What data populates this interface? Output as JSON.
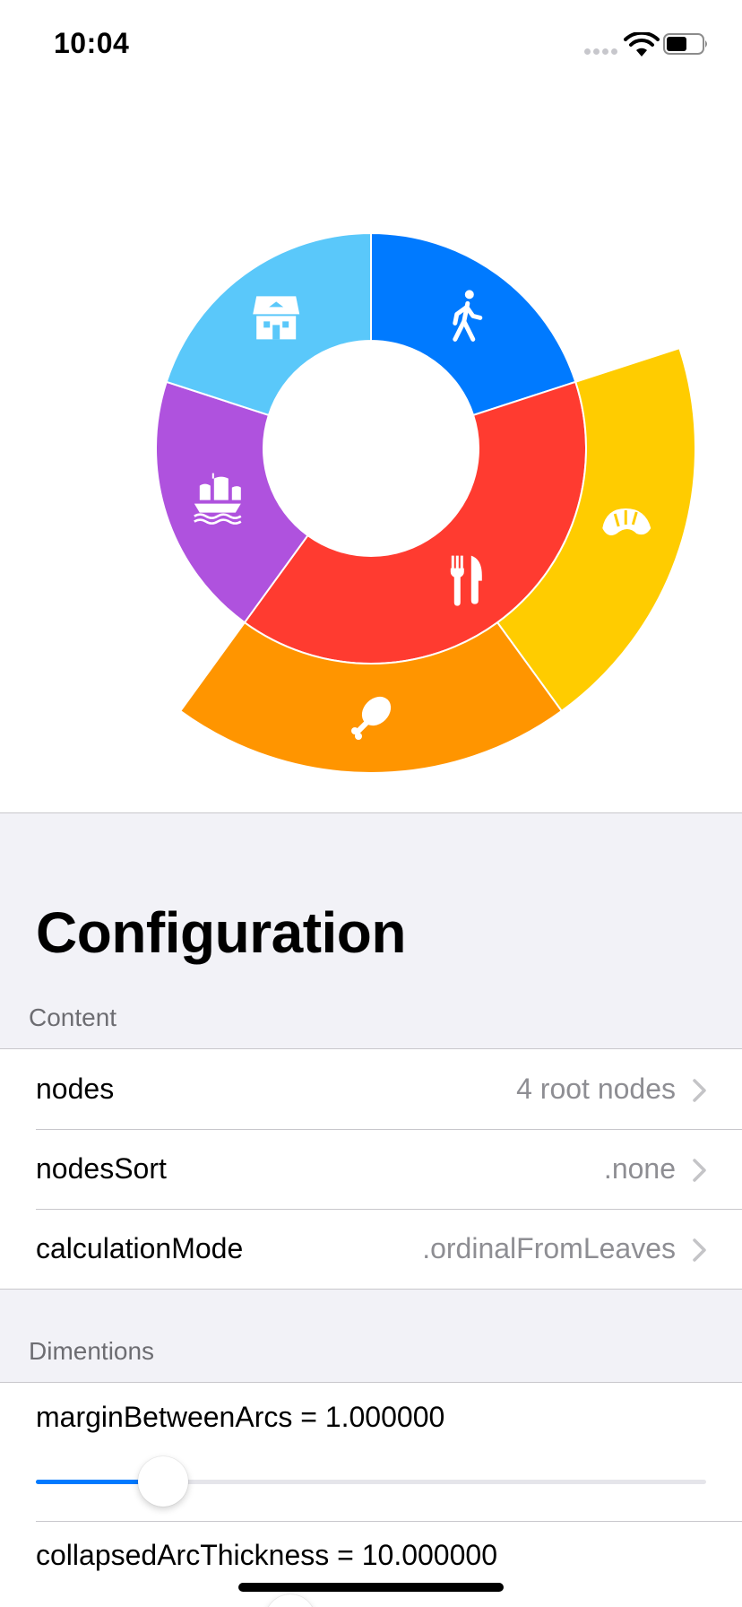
{
  "status_bar": {
    "time": "10:04"
  },
  "sunburst": {
    "inner_ring": [
      {
        "name": "walking",
        "icon": "walking-person-icon",
        "color": "#007AFF",
        "value": 1
      },
      {
        "name": "food",
        "icon": "fork-knife-icon",
        "color": "#FF3B30",
        "value": 2
      },
      {
        "name": "ship",
        "icon": "sailing-ship-icon",
        "color": "#AF52DE",
        "value": 1
      },
      {
        "name": "house",
        "icon": "house-icon",
        "color": "#5AC8FA",
        "value": 1
      }
    ],
    "outer_ring": [
      {
        "parent": "food",
        "icon": "croissant-icon",
        "color": "#FFCC00",
        "value": 1
      },
      {
        "parent": "food",
        "icon": "chicken-leg-icon",
        "color": "#FF9500",
        "value": 1
      }
    ]
  },
  "config": {
    "title": "Configuration",
    "content_header": "Content",
    "content_rows": [
      {
        "label": "nodes",
        "value": "4 root nodes"
      },
      {
        "label": "nodesSort",
        "value": ".none"
      },
      {
        "label": "calculationMode",
        "value": ".ordinalFromLeaves"
      }
    ],
    "dimensions_header": "Dimentions",
    "sliders": [
      {
        "label": "marginBetweenArcs = 1.000000",
        "fraction": 0.19
      },
      {
        "label": "collapsedArcThickness = 10.000000",
        "fraction": 0.38
      }
    ]
  },
  "colors": {
    "accent": "#007AFF",
    "group_background": "#F2F2F7",
    "separator": "#C8C7CC",
    "secondary_text": "#8E8E93"
  }
}
